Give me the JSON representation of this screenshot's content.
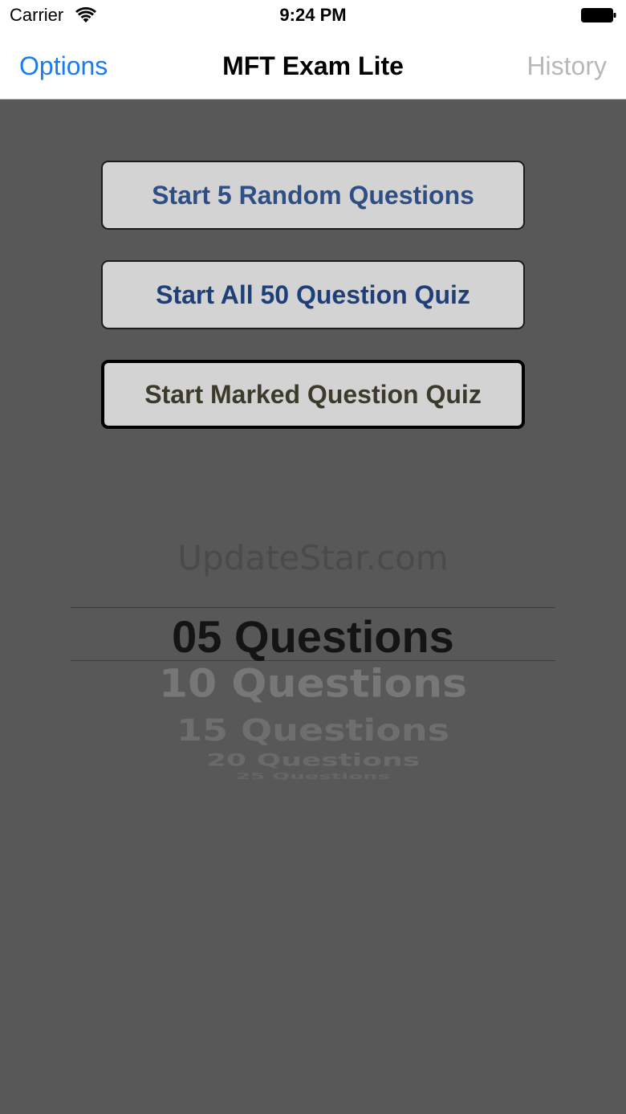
{
  "status_bar": {
    "carrier": "Carrier",
    "time": "9:24 PM",
    "wifi_icon": "wifi-icon",
    "battery_icon": "battery-icon"
  },
  "nav_bar": {
    "left_label": "Options",
    "title": "MFT Exam Lite",
    "right_label": "History"
  },
  "buttons": {
    "random": "Start 5 Random Questions",
    "all": "Start All 50 Question Quiz",
    "marked": "Start Marked Question Quiz"
  },
  "watermark": "UpdateStar.com",
  "picker": {
    "selected": "05 Questions",
    "options": [
      "10 Questions",
      "15 Questions",
      "20 Questions",
      "25 Questions"
    ]
  },
  "colors": {
    "accent": "#1a7cf1",
    "background": "#585858",
    "button_bg": "#d3d3d3"
  }
}
